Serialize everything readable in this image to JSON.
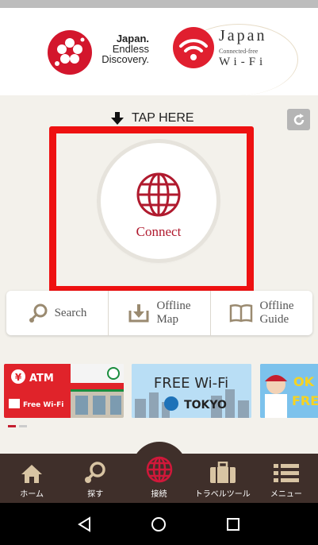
{
  "header": {
    "japan_logo": {
      "line1": "Japan.",
      "line2": "Endless",
      "line3": "Discovery."
    },
    "wifi_logo": {
      "title": "Japan",
      "subtitle": "Connected-free",
      "wifi": "Wi-Fi"
    }
  },
  "tap_here": "TAP HERE",
  "connect": {
    "label": "Connect"
  },
  "features": [
    {
      "label": "Search"
    },
    {
      "label_line1": "Offline",
      "label_line2": "Map"
    },
    {
      "label_line1": "Offline",
      "label_line2": "Guide"
    }
  ],
  "banners": {
    "atm": {
      "label": "ATM",
      "free_wifi": "Free Wi-Fi"
    },
    "tokyo": {
      "line1": "FREE Wi-Fi",
      "line2": "TOKYO"
    },
    "third": {
      "line1": "OK",
      "line2": "FRE"
    }
  },
  "tabs": [
    {
      "label": "ホーム",
      "icon": "home-icon"
    },
    {
      "label": "探す",
      "icon": "search-pin-icon"
    },
    {
      "label": "接続",
      "icon": "globe-icon"
    },
    {
      "label": "トラベルツール",
      "icon": "suitcase-icon"
    },
    {
      "label": "メニュー",
      "icon": "menu-icon"
    }
  ],
  "colors": {
    "accent": "#b01a2e",
    "highlight_frame": "#ee1111",
    "tabbar": "#3f2f2a"
  }
}
